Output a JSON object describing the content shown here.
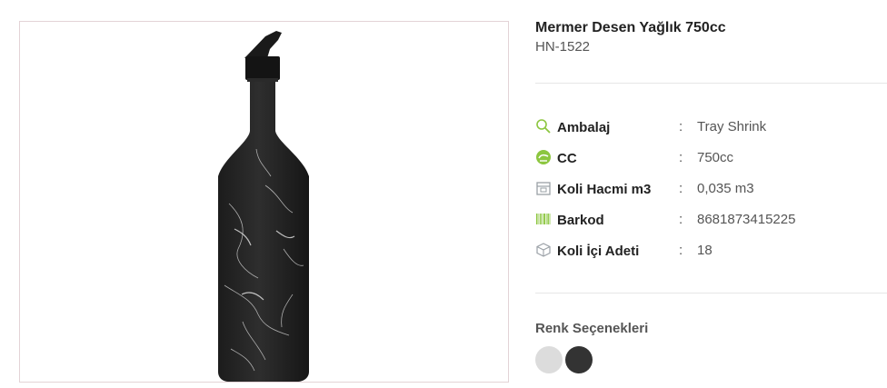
{
  "product": {
    "title": "Mermer Desen Yağlık 750cc",
    "code": "HN-1522"
  },
  "specs": [
    {
      "icon": "magnifier-icon",
      "label": "Ambalaj",
      "colon": ":",
      "value": "Tray Shrink"
    },
    {
      "icon": "volume-icon",
      "label": "CC",
      "colon": ":",
      "value": "750cc"
    },
    {
      "icon": "box-icon",
      "label": "Koli Hacmi m3",
      "colon": ":",
      "value": "0,035 m3"
    },
    {
      "icon": "barcode-icon",
      "label": "Barkod",
      "colon": ":",
      "value": "8681873415225"
    },
    {
      "icon": "cube-icon",
      "label": "Koli İçi Adeti",
      "colon": ":",
      "value": "18"
    }
  ],
  "colors": {
    "title": "Renk Seçenekleri",
    "options": [
      {
        "name": "light-gray",
        "hex": "#dcdcdc"
      },
      {
        "name": "black",
        "hex": "#333333"
      }
    ]
  },
  "theme": {
    "accent": "#8cc63f",
    "icon_gray": "#9aa0a6"
  }
}
